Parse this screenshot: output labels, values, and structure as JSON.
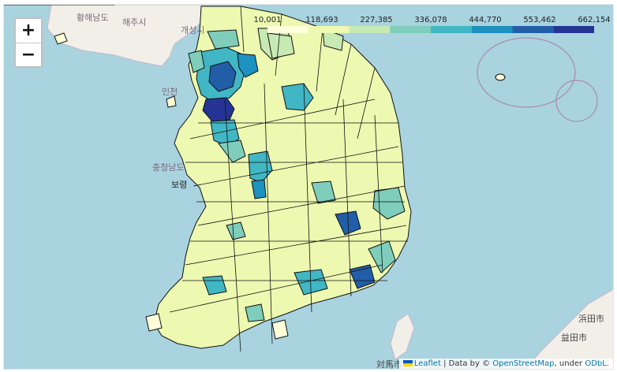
{
  "map": {
    "zoom_in_label": "+",
    "zoom_out_label": "−",
    "legend": {
      "ticks": [
        "10,001",
        "118,693",
        "227,385",
        "336,078",
        "444,770",
        "553,462",
        "662,154"
      ],
      "colors": [
        "#ffffd9",
        "#edf8b1",
        "#c7e9b4",
        "#7fcdbb",
        "#41b6c4",
        "#1d91c0",
        "#225ea8",
        "#253494"
      ]
    },
    "places": {
      "hwanghae": "황해남도",
      "haeju": "해주시",
      "kaesong": "개성시",
      "incheon": "인천",
      "chungnam": "충청남도",
      "boryeong": "보령",
      "tsushima": "対馬市",
      "hamada": "浜田市",
      "masuda": "益田市"
    },
    "attribution": {
      "leaflet": "Leaflet",
      "separator": " | Data by © ",
      "osm": "OpenStreetMap",
      "under": ", under ",
      "odbl": "ODbL."
    },
    "colors": {
      "sea": "#a9d3df",
      "land": "#f2efe9",
      "boundary": "#000000"
    }
  }
}
